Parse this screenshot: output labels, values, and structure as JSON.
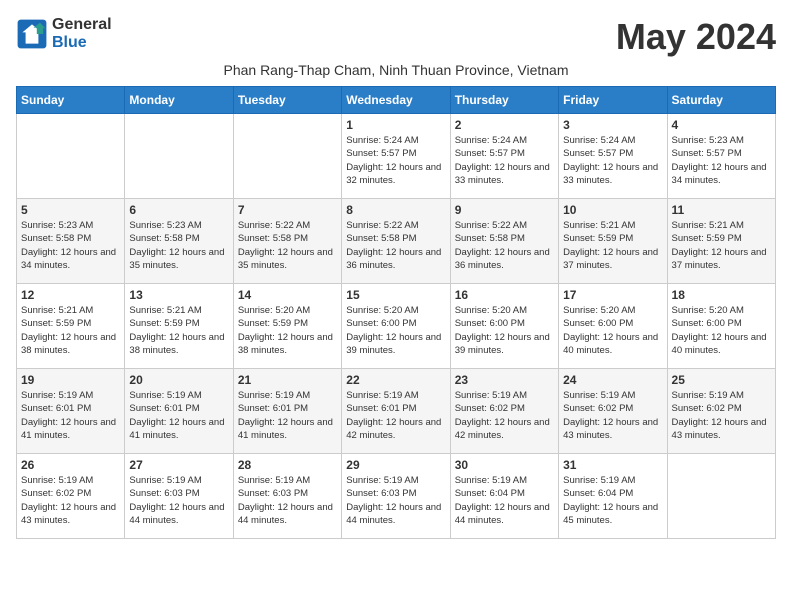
{
  "logo": {
    "line1": "General",
    "line2": "Blue"
  },
  "title": "May 2024",
  "subtitle": "Phan Rang-Thap Cham, Ninh Thuan Province, Vietnam",
  "headers": [
    "Sunday",
    "Monday",
    "Tuesday",
    "Wednesday",
    "Thursday",
    "Friday",
    "Saturday"
  ],
  "weeks": [
    [
      {
        "day": "",
        "sunrise": "",
        "sunset": "",
        "daylight": ""
      },
      {
        "day": "",
        "sunrise": "",
        "sunset": "",
        "daylight": ""
      },
      {
        "day": "",
        "sunrise": "",
        "sunset": "",
        "daylight": ""
      },
      {
        "day": "1",
        "sunrise": "Sunrise: 5:24 AM",
        "sunset": "Sunset: 5:57 PM",
        "daylight": "Daylight: 12 hours and 32 minutes."
      },
      {
        "day": "2",
        "sunrise": "Sunrise: 5:24 AM",
        "sunset": "Sunset: 5:57 PM",
        "daylight": "Daylight: 12 hours and 33 minutes."
      },
      {
        "day": "3",
        "sunrise": "Sunrise: 5:24 AM",
        "sunset": "Sunset: 5:57 PM",
        "daylight": "Daylight: 12 hours and 33 minutes."
      },
      {
        "day": "4",
        "sunrise": "Sunrise: 5:23 AM",
        "sunset": "Sunset: 5:57 PM",
        "daylight": "Daylight: 12 hours and 34 minutes."
      }
    ],
    [
      {
        "day": "5",
        "sunrise": "Sunrise: 5:23 AM",
        "sunset": "Sunset: 5:58 PM",
        "daylight": "Daylight: 12 hours and 34 minutes."
      },
      {
        "day": "6",
        "sunrise": "Sunrise: 5:23 AM",
        "sunset": "Sunset: 5:58 PM",
        "daylight": "Daylight: 12 hours and 35 minutes."
      },
      {
        "day": "7",
        "sunrise": "Sunrise: 5:22 AM",
        "sunset": "Sunset: 5:58 PM",
        "daylight": "Daylight: 12 hours and 35 minutes."
      },
      {
        "day": "8",
        "sunrise": "Sunrise: 5:22 AM",
        "sunset": "Sunset: 5:58 PM",
        "daylight": "Daylight: 12 hours and 36 minutes."
      },
      {
        "day": "9",
        "sunrise": "Sunrise: 5:22 AM",
        "sunset": "Sunset: 5:58 PM",
        "daylight": "Daylight: 12 hours and 36 minutes."
      },
      {
        "day": "10",
        "sunrise": "Sunrise: 5:21 AM",
        "sunset": "Sunset: 5:59 PM",
        "daylight": "Daylight: 12 hours and 37 minutes."
      },
      {
        "day": "11",
        "sunrise": "Sunrise: 5:21 AM",
        "sunset": "Sunset: 5:59 PM",
        "daylight": "Daylight: 12 hours and 37 minutes."
      }
    ],
    [
      {
        "day": "12",
        "sunrise": "Sunrise: 5:21 AM",
        "sunset": "Sunset: 5:59 PM",
        "daylight": "Daylight: 12 hours and 38 minutes."
      },
      {
        "day": "13",
        "sunrise": "Sunrise: 5:21 AM",
        "sunset": "Sunset: 5:59 PM",
        "daylight": "Daylight: 12 hours and 38 minutes."
      },
      {
        "day": "14",
        "sunrise": "Sunrise: 5:20 AM",
        "sunset": "Sunset: 5:59 PM",
        "daylight": "Daylight: 12 hours and 38 minutes."
      },
      {
        "day": "15",
        "sunrise": "Sunrise: 5:20 AM",
        "sunset": "Sunset: 6:00 PM",
        "daylight": "Daylight: 12 hours and 39 minutes."
      },
      {
        "day": "16",
        "sunrise": "Sunrise: 5:20 AM",
        "sunset": "Sunset: 6:00 PM",
        "daylight": "Daylight: 12 hours and 39 minutes."
      },
      {
        "day": "17",
        "sunrise": "Sunrise: 5:20 AM",
        "sunset": "Sunset: 6:00 PM",
        "daylight": "Daylight: 12 hours and 40 minutes."
      },
      {
        "day": "18",
        "sunrise": "Sunrise: 5:20 AM",
        "sunset": "Sunset: 6:00 PM",
        "daylight": "Daylight: 12 hours and 40 minutes."
      }
    ],
    [
      {
        "day": "19",
        "sunrise": "Sunrise: 5:19 AM",
        "sunset": "Sunset: 6:01 PM",
        "daylight": "Daylight: 12 hours and 41 minutes."
      },
      {
        "day": "20",
        "sunrise": "Sunrise: 5:19 AM",
        "sunset": "Sunset: 6:01 PM",
        "daylight": "Daylight: 12 hours and 41 minutes."
      },
      {
        "day": "21",
        "sunrise": "Sunrise: 5:19 AM",
        "sunset": "Sunset: 6:01 PM",
        "daylight": "Daylight: 12 hours and 41 minutes."
      },
      {
        "day": "22",
        "sunrise": "Sunrise: 5:19 AM",
        "sunset": "Sunset: 6:01 PM",
        "daylight": "Daylight: 12 hours and 42 minutes."
      },
      {
        "day": "23",
        "sunrise": "Sunrise: 5:19 AM",
        "sunset": "Sunset: 6:02 PM",
        "daylight": "Daylight: 12 hours and 42 minutes."
      },
      {
        "day": "24",
        "sunrise": "Sunrise: 5:19 AM",
        "sunset": "Sunset: 6:02 PM",
        "daylight": "Daylight: 12 hours and 43 minutes."
      },
      {
        "day": "25",
        "sunrise": "Sunrise: 5:19 AM",
        "sunset": "Sunset: 6:02 PM",
        "daylight": "Daylight: 12 hours and 43 minutes."
      }
    ],
    [
      {
        "day": "26",
        "sunrise": "Sunrise: 5:19 AM",
        "sunset": "Sunset: 6:02 PM",
        "daylight": "Daylight: 12 hours and 43 minutes."
      },
      {
        "day": "27",
        "sunrise": "Sunrise: 5:19 AM",
        "sunset": "Sunset: 6:03 PM",
        "daylight": "Daylight: 12 hours and 44 minutes."
      },
      {
        "day": "28",
        "sunrise": "Sunrise: 5:19 AM",
        "sunset": "Sunset: 6:03 PM",
        "daylight": "Daylight: 12 hours and 44 minutes."
      },
      {
        "day": "29",
        "sunrise": "Sunrise: 5:19 AM",
        "sunset": "Sunset: 6:03 PM",
        "daylight": "Daylight: 12 hours and 44 minutes."
      },
      {
        "day": "30",
        "sunrise": "Sunrise: 5:19 AM",
        "sunset": "Sunset: 6:04 PM",
        "daylight": "Daylight: 12 hours and 44 minutes."
      },
      {
        "day": "31",
        "sunrise": "Sunrise: 5:19 AM",
        "sunset": "Sunset: 6:04 PM",
        "daylight": "Daylight: 12 hours and 45 minutes."
      },
      {
        "day": "",
        "sunrise": "",
        "sunset": "",
        "daylight": ""
      }
    ]
  ]
}
